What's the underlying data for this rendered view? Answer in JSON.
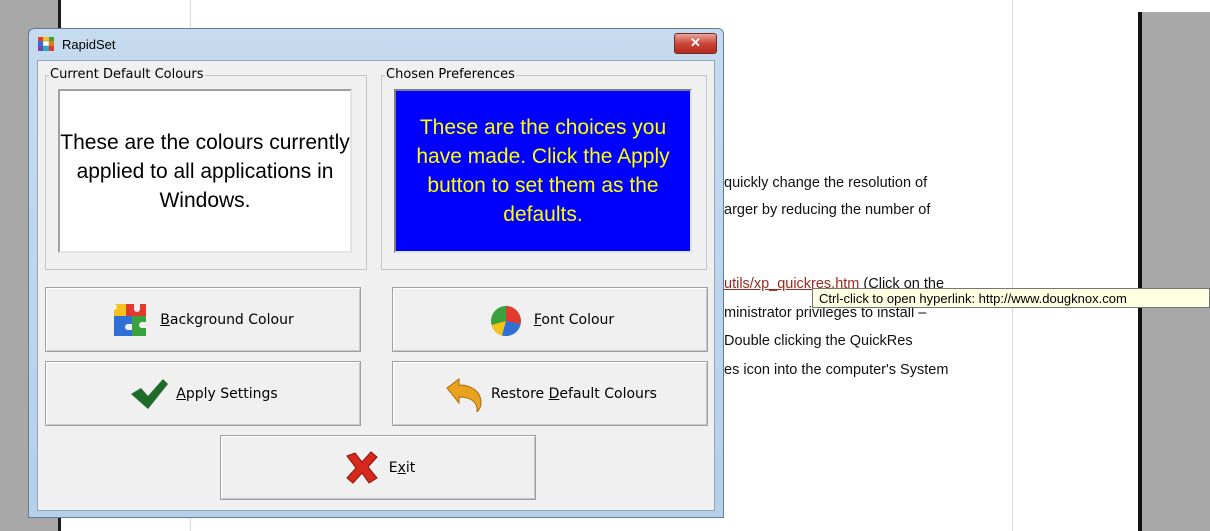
{
  "document": {
    "lines": [
      "quickly change the resolution of",
      "arger by reducing the number of",
      "ministrator privileges to install –",
      "Double clicking the QuickRes",
      "es icon into the computer's System"
    ],
    "link_text": "utils/xp_quickres.htm",
    "link_suffix": " (Click on the",
    "tooltip": "Ctrl-click to open hyperlink: http://www.dougknox.com"
  },
  "window": {
    "title": "RapidSet",
    "close_label": "✕"
  },
  "groups": {
    "current": {
      "label": "Current Default Colours",
      "preview_text": "These are the colours currently applied to all applications in Windows."
    },
    "chosen": {
      "label": "Chosen Preferences",
      "preview_text": "These are the choices you have made.  Click the Apply button to set them as the defaults."
    }
  },
  "buttons": {
    "background": {
      "pre": "",
      "key": "B",
      "post": "ackground Colour",
      "icon": "puzzle-icon"
    },
    "font": {
      "pre": "",
      "key": "F",
      "post": "ont Colour",
      "icon": "pie-chart-icon"
    },
    "apply": {
      "pre": "",
      "key": "A",
      "post": "pply Settings",
      "icon": "checkmark-icon"
    },
    "restore": {
      "pre": "Restore ",
      "key": "D",
      "post": "efault Colours",
      "icon": "undo-arrow-icon"
    },
    "exit": {
      "pre": "E",
      "key": "x",
      "post": "it",
      "icon": "red-x-icon"
    }
  },
  "colors": {
    "chosen_background": "#0000ff",
    "chosen_text": "#ffff00",
    "current_background": "#ffffff",
    "current_text": "#000000"
  }
}
